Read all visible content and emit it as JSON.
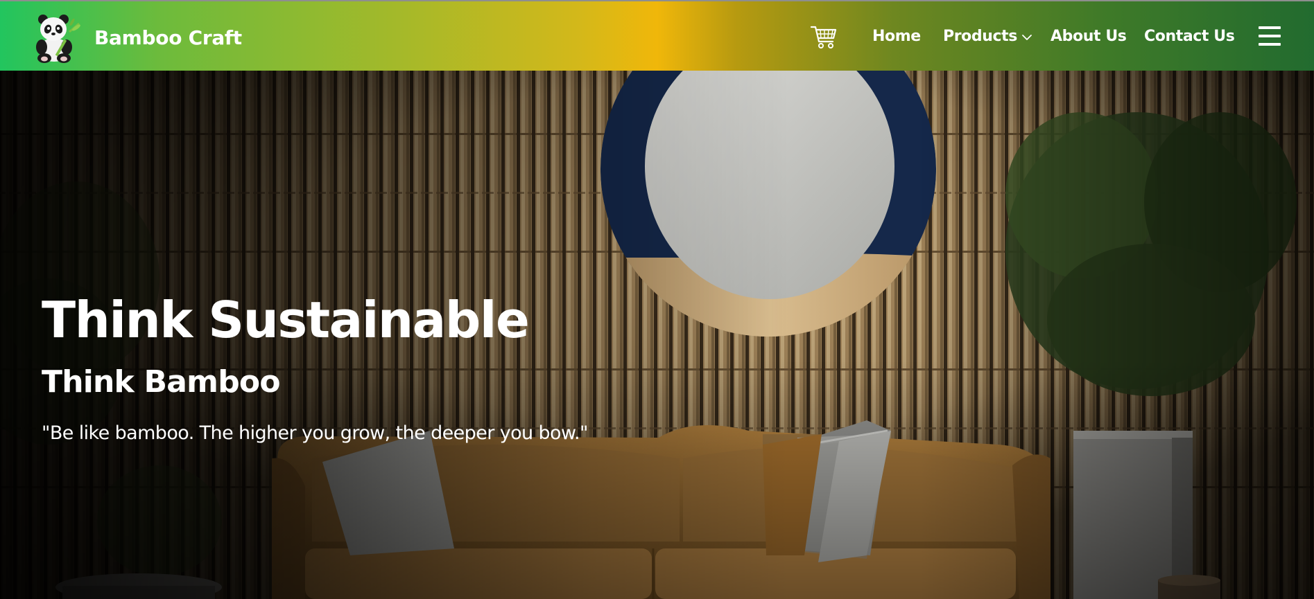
{
  "navbar": {
    "brand_name": "Bamboo Craft",
    "brand_logo_icon": "panda-icon",
    "cart_icon": "shopping-cart-icon",
    "links": [
      {
        "label": "Home"
      },
      {
        "label": "Products",
        "has_dropdown": true
      },
      {
        "label": "About Us"
      },
      {
        "label": "Contact Us"
      }
    ],
    "menu_icon": "hamburger-menu-icon"
  },
  "hero": {
    "title": "Think Sustainable",
    "subtitle": "Think Bamboo",
    "quote": "\"Be like bamboo. The higher you grow, the deeper you bow.\"",
    "background_icon": "bamboo-living-room-photo"
  },
  "colors": {
    "nav_gradient_start": "#22c55e",
    "nav_gradient_mid": "#f0b70a",
    "nav_gradient_end": "#226b2f",
    "text": "#ffffff"
  }
}
